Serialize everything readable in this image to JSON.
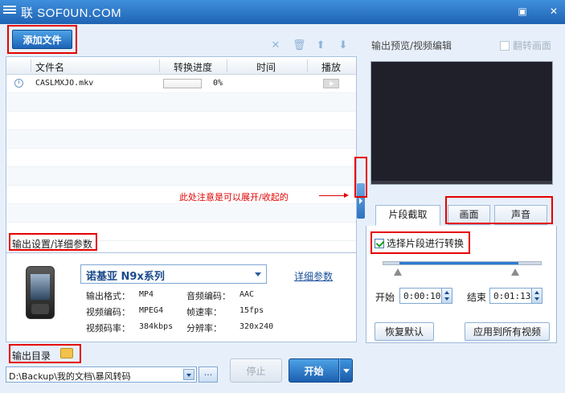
{
  "window": {
    "title": "联 SOF0UN.COM",
    "min_icon": "minimize-icon",
    "close_icon": "close-icon",
    "min_glyph": "▣",
    "close_glyph": "✕"
  },
  "toolbar": {
    "add_file": "添加文件",
    "delete_glyph": "✕",
    "clear_glyph": "🗑",
    "up_glyph": "⬆",
    "down_glyph": "⬇"
  },
  "file_list": {
    "columns": [
      "文件名",
      "转换进度",
      "时间",
      "播放"
    ],
    "rows": [
      {
        "name": "CASLMXJO.mkv",
        "progress_pct": 0,
        "progress_text": "0%",
        "time": ""
      }
    ]
  },
  "annotation": {
    "collapse_note": "此处注意是可以展开/收起的"
  },
  "output_settings": {
    "label": "输出设置/详细参数",
    "device": "诺基亚 N9x系列",
    "detail_link": "详细参数",
    "params": [
      {
        "k": "输出格式：",
        "v": "MP4"
      },
      {
        "k": "音频编码：",
        "v": "AAC"
      },
      {
        "k": "视频编码：",
        "v": "MPEG4"
      },
      {
        "k": "帧速率：",
        "v": "15fps"
      },
      {
        "k": "视频码率：",
        "v": "384kbps"
      },
      {
        "k": "分辨率：",
        "v": "320x240"
      }
    ]
  },
  "output_dir": {
    "label": "输出目录",
    "path": "D:\\Backup\\我的文档\\暴风转码",
    "browse": "..."
  },
  "actions": {
    "stop": "停止",
    "start": "开始"
  },
  "preview": {
    "title": "输出预览/视频编辑",
    "flip_label": "翻转画面"
  },
  "edit_tabs": {
    "tabs": [
      "片段截取",
      "画面",
      "声音"
    ],
    "active": "片段截取",
    "select_clip_label": "选择片段进行转换",
    "select_clip_checked": true,
    "start_label": "开始",
    "start_time": "0:00:10",
    "end_label": "结束",
    "end_time": "0:01:13",
    "reset": "恢复默认",
    "apply_all": "应用到所有视频"
  },
  "colors": {
    "accent": "#1c63b6",
    "highlight": "#e60000",
    "background": "#e7f0fa"
  }
}
